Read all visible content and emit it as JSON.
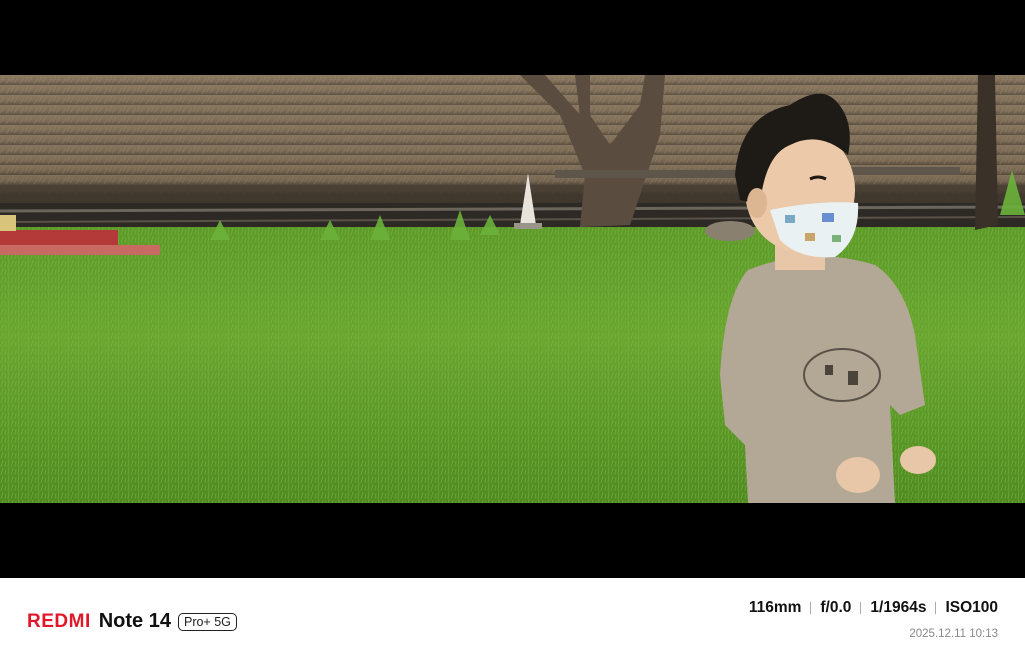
{
  "photo": {
    "description_icon": "photo-scene"
  },
  "watermark": {
    "brand": "REDMI",
    "model": "Note 14",
    "edition": "Pro+ 5G",
    "brand_color": "#e0182a",
    "exif": {
      "focal_length": "116mm",
      "aperture": "f/0.0",
      "shutter": "1/1964s",
      "iso": "ISO100"
    },
    "datetime": "2025.12.11 10:13"
  }
}
